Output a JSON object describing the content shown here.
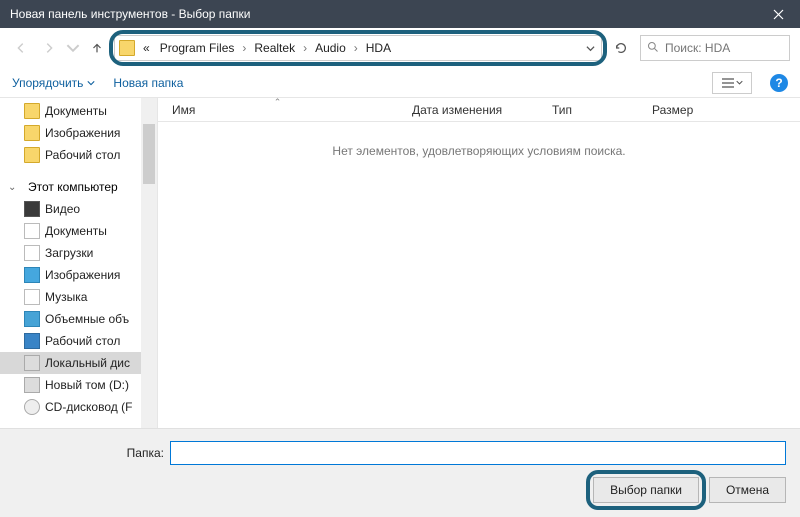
{
  "titlebar": {
    "title": "Новая панель инструментов - Выбор папки"
  },
  "breadcrumb": {
    "prefix": "«",
    "segments": [
      "Program Files",
      "Realtek",
      "Audio",
      "HDA"
    ]
  },
  "search": {
    "placeholder": "Поиск: HDA"
  },
  "toolbar": {
    "organize": "Упорядочить",
    "newfolder": "Новая папка",
    "help": "?"
  },
  "tree": [
    {
      "icon": "ti-folder",
      "label": "Документы",
      "indent": 24
    },
    {
      "icon": "ti-folder",
      "label": "Изображения",
      "indent": 24
    },
    {
      "icon": "ti-folder",
      "label": "Рабочий стол",
      "indent": 24
    },
    {
      "group": true,
      "icon": "ti-pc",
      "label": "Этот компьютер",
      "indent": 8
    },
    {
      "icon": "ti-video",
      "label": "Видео",
      "indent": 24
    },
    {
      "icon": "ti-doc",
      "label": "Документы",
      "indent": 24
    },
    {
      "icon": "ti-dl",
      "label": "Загрузки",
      "indent": 24
    },
    {
      "icon": "ti-img",
      "label": "Изображения",
      "indent": 24
    },
    {
      "icon": "ti-music",
      "label": "Музыка",
      "indent": 24
    },
    {
      "icon": "ti-3d",
      "label": "Объемные объ",
      "indent": 24
    },
    {
      "icon": "ti-desk",
      "label": "Рабочий стол",
      "indent": 24
    },
    {
      "icon": "ti-disk",
      "label": "Локальный дис",
      "indent": 24,
      "selected": true
    },
    {
      "icon": "ti-disk",
      "label": "Новый том (D:)",
      "indent": 24
    },
    {
      "icon": "ti-cd",
      "label": "CD-дисковод (F",
      "indent": 24
    }
  ],
  "columns": {
    "name": "Имя",
    "date": "Дата изменения",
    "type": "Тип",
    "size": "Размер"
  },
  "empty": "Нет элементов, удовлетворяющих условиям поиска.",
  "footer": {
    "label": "Папка:",
    "value": "",
    "ok": "Выбор папки",
    "cancel": "Отмена"
  }
}
